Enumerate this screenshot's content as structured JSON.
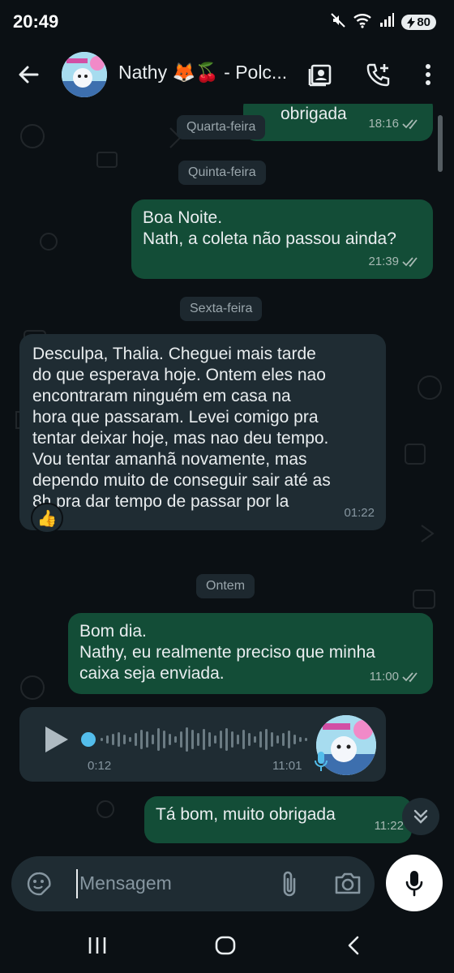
{
  "status_bar": {
    "time": "20:49",
    "battery": "80",
    "icons": [
      "mute-icon",
      "wifi-icon",
      "signal-icon",
      "battery-charging-icon"
    ]
  },
  "header": {
    "back_icon": "arrow-left-icon",
    "contact_name": "Nathy 🦊🍒 - Polc...",
    "avatar_text": "POLCA · MAIS · MELHOR",
    "actions": [
      "contact-card-icon",
      "add-call-icon",
      "more-vert-icon"
    ]
  },
  "chat": {
    "date_labels": {
      "wednesday": "Quarta-feira",
      "thursday": "Quinta-feira",
      "friday": "Sexta-feira",
      "yesterday": "Ontem"
    },
    "messages": [
      {
        "dir": "out",
        "lines": [
          "obrigada"
        ],
        "time": "18:16"
      },
      {
        "dir": "out",
        "lines": [
          "Boa Noite.",
          "Nath, a coleta não passou ainda?"
        ],
        "time": "21:39"
      },
      {
        "dir": "in",
        "lines": [
          "Desculpa, Thalia. Cheguei mais tarde",
          "do que esperava hoje. Ontem eles nao",
          "encontraram ninguém em casa na",
          "hora que passaram. Levei comigo pra",
          "tentar deixar hoje, mas nao deu tempo.",
          "Vou tentar amanhã novamente, mas",
          "dependo muito de conseguir sair até as",
          "8h pra dar tempo de passar por la"
        ],
        "time": "01:22",
        "reaction": "👍"
      },
      {
        "dir": "out",
        "lines": [
          "Bom dia.",
          "Nathy, eu realmente preciso que minha",
          "caixa seja enviada."
        ],
        "time": "11:00"
      },
      {
        "dir": "in",
        "type": "audio",
        "duration": "0:12",
        "time": "11:01",
        "progress": 0.0
      },
      {
        "dir": "out",
        "lines": [
          "Tá bom, muito obrigada"
        ],
        "time": "11:22"
      }
    ]
  },
  "composer": {
    "placeholder": "Mensagem",
    "icons": [
      "sticker-icon",
      "attach-icon",
      "camera-icon",
      "mic-icon"
    ]
  },
  "nav": [
    "recents-icon",
    "home-icon",
    "back-icon"
  ],
  "colors": {
    "outgoing_bubble": "#134d37",
    "incoming_bubble": "#1f2c33",
    "background": "#0b1014",
    "tick": "#a7b9b3",
    "audio_dot": "#53bdeb"
  }
}
